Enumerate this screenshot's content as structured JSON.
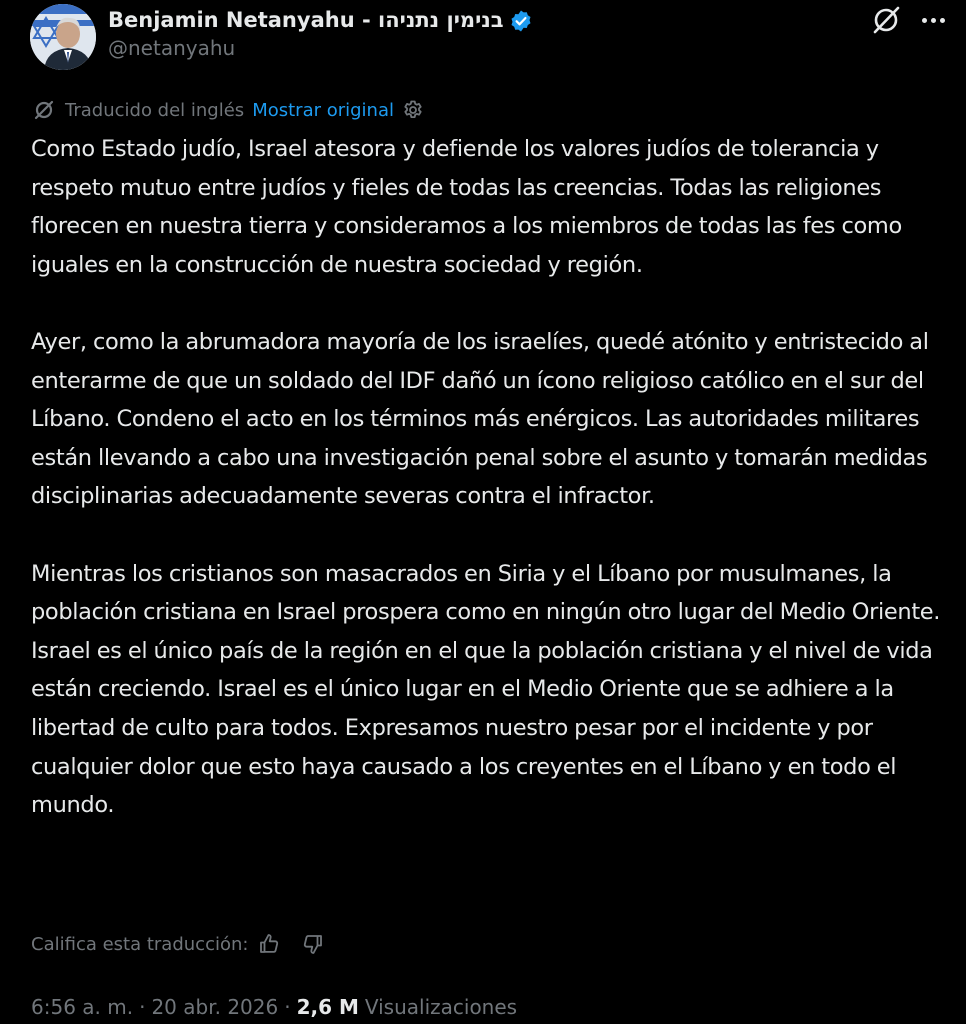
{
  "author": {
    "display_name": "Benjamin Netanyahu - בנימין נתניהו",
    "handle": "@netanyahu",
    "verified_badge_color": "#1d9bf0",
    "avatar_icon": "profile-photo"
  },
  "header_actions": {
    "grok_icon": "grok-icon",
    "more_icon": "more-horizontal-icon"
  },
  "translation": {
    "label": "Traducido del inglés",
    "show_original": "Mostrar original",
    "icon": "translate-icon",
    "settings_icon": "gear-icon"
  },
  "post": {
    "paragraphs": [
      "Como Estado judío, Israel atesora y defiende los valores judíos de tolerancia y respeto mutuo entre judíos y fieles de todas las creencias. Todas las religiones florecen en nuestra tierra y consideramos a los miembros de todas las fes como iguales en la construcción de nuestra sociedad y región.",
      "Ayer, como la abrumadora mayoría de los israelíes, quedé atónito y entristecido al enterarme de que un soldado del IDF dañó un ícono religioso católico en el sur del Líbano. Condeno el acto en los términos más enérgicos. Las autoridades militares están llevando a cabo una investigación penal sobre el asunto y tomarán medidas disciplinarias adecuadamente severas contra el infractor.",
      "Mientras los cristianos son masacrados en Siria y el Líbano por musulmanes, la población cristiana en Israel prospera como en ningún otro lugar del Medio Oriente. Israel es el único país de la región en el que la población cristiana y el nivel de vida están creciendo. Israel es el único lugar en el Medio Oriente que se adhiere a la libertad de culto para todos. Expresamos nuestro pesar por el incidente y por cualquier dolor que esto haya causado a los creyentes en el Líbano y en todo el mundo."
    ]
  },
  "rating": {
    "label": "Califica esta traducción:",
    "thumbs_up_icon": "thumbs-up-icon",
    "thumbs_down_icon": "thumbs-down-icon"
  },
  "meta": {
    "time": "6:56 a. m.",
    "separator": "·",
    "date": "20 abr. 2026",
    "views_count": "2,6 M",
    "views_label": "Visualizaciones"
  },
  "colors": {
    "background": "#000000",
    "primary_text": "#e7e9ea",
    "secondary_text": "#71767b",
    "accent": "#1d9bf0"
  }
}
